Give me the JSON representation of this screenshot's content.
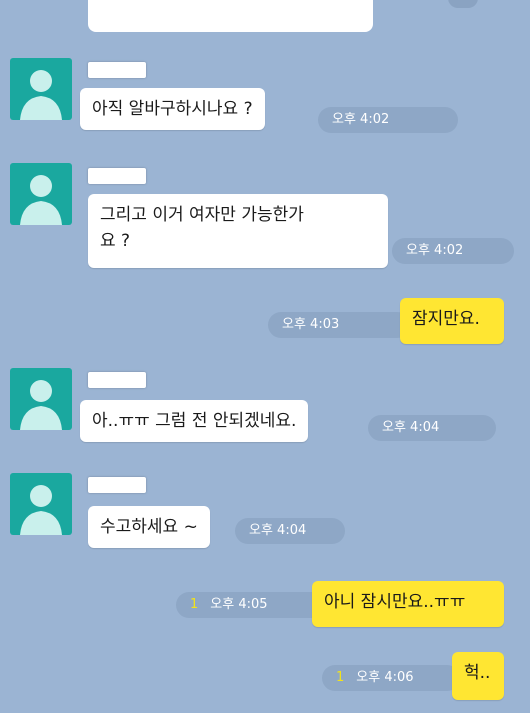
{
  "colors": {
    "background": "#9bb4d3",
    "my_bubble": "#ffe632",
    "their_bubble": "#ffffff",
    "avatar": "#1aa89f",
    "unread": "#f2e21a"
  },
  "messages": [
    {
      "sender": "them",
      "text": "아직 알바구하시나요 ?",
      "time": "오후 4:02"
    },
    {
      "sender": "them",
      "text": "그리고 이거 여자만 가능한가\n요 ?",
      "time": "오후 4:02"
    },
    {
      "sender": "me",
      "text": "잠지만요.",
      "time": "오후 4:03"
    },
    {
      "sender": "them",
      "text": "아..ㅠㅠ 그럼 전 안되겠네요.",
      "time": "오후 4:04"
    },
    {
      "sender": "them",
      "text": "수고하세요 ~",
      "time": "오후 4:04"
    },
    {
      "sender": "me",
      "text": "아니 잠시만요..ㅠㅠ",
      "time": "오후 4:05",
      "unread": "1"
    },
    {
      "sender": "me",
      "text": "헉..",
      "time": "오후 4:06",
      "unread": "1"
    }
  ]
}
